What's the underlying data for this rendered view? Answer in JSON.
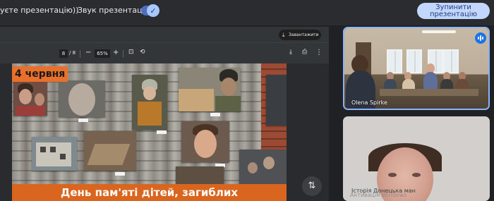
{
  "top_bar": {
    "presenting_text": "уєте презентацію))",
    "audio_label": "Звук презентації",
    "audio_toggle_checked": true,
    "stop_button": [
      "Зупинити",
      "презентацію"
    ]
  },
  "pdf_viewer": {
    "download_label": "Завантажити",
    "page_current": "8",
    "page_total": "/ 8",
    "zoom": "65%",
    "slide": {
      "date": "4 червня",
      "banner": "День пам'яті дітей, загиблих"
    }
  },
  "participants": [
    {
      "name": "Olena Spirke",
      "speaking": true
    },
    {
      "name": "Історія Донецька ман"
    }
  ],
  "overlay_text": "Активація Windows",
  "colors": {
    "accent": "#8ab4f8",
    "stop_button_bg": "#c2d7fb",
    "slide_orange": "#d9651f",
    "speaking_blue": "#1a73e8"
  },
  "icons": {
    "download": "download-icon",
    "zoom_out": "minus-icon",
    "zoom_in": "plus-icon",
    "fit": "fit-page-icon",
    "rotate": "rotate-icon",
    "print": "print-icon",
    "more": "more-vert-icon",
    "swap": "swap-vert-icon",
    "voice": "voice-activity-icon",
    "check": "check-icon"
  }
}
